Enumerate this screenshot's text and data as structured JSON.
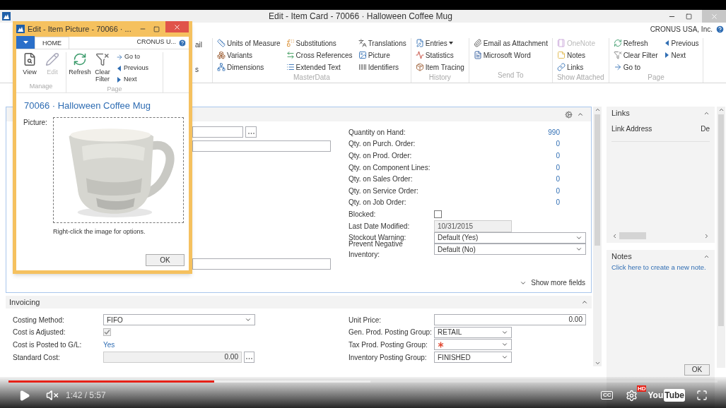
{
  "window": {
    "title": "Edit - Item Card - 70066 · Halloween Coffee Mug",
    "company": "CRONUS USA, Inc.",
    "ribbon": {
      "cut_items": [
        "ail",
        "s"
      ],
      "groups": [
        {
          "label": "MasterData",
          "columns": [
            [
              {
                "label": "Units of Measure",
                "disabled": false,
                "dropdown": false
              },
              {
                "label": "Variants",
                "disabled": false,
                "dropdown": false
              },
              {
                "label": "Dimensions",
                "disabled": false,
                "dropdown": false
              }
            ],
            [
              {
                "label": "Substitutions",
                "disabled": false,
                "dropdown": false
              },
              {
                "label": "Cross References",
                "disabled": false,
                "dropdown": false
              },
              {
                "label": "Extended Text",
                "disabled": false,
                "dropdown": false
              }
            ],
            [
              {
                "label": "Translations",
                "disabled": false,
                "dropdown": false
              },
              {
                "label": "Picture",
                "disabled": false,
                "dropdown": false
              },
              {
                "label": "Identifiers",
                "disabled": false,
                "dropdown": false
              }
            ]
          ]
        },
        {
          "label": "History",
          "columns": [
            [
              {
                "label": "Entries",
                "disabled": false,
                "dropdown": true
              },
              {
                "label": "Statistics",
                "disabled": false,
                "dropdown": false
              },
              {
                "label": "Item Tracing",
                "disabled": false,
                "dropdown": false
              }
            ]
          ]
        },
        {
          "label": "Send To",
          "columns": [
            [
              {
                "label": "Email as Attachment",
                "disabled": false,
                "dropdown": false
              },
              {
                "label": "Microsoft Word",
                "disabled": false,
                "dropdown": false
              }
            ]
          ]
        },
        {
          "label": "Show Attached",
          "columns": [
            [
              {
                "label": "OneNote",
                "disabled": true,
                "dropdown": false
              },
              {
                "label": "Notes",
                "disabled": false,
                "dropdown": false
              },
              {
                "label": "Links",
                "disabled": false,
                "dropdown": false
              }
            ]
          ]
        },
        {
          "label": "Page",
          "columns": [
            [
              {
                "label": "Refresh",
                "disabled": false,
                "dropdown": false
              },
              {
                "label": "Clear Filter",
                "disabled": false,
                "dropdown": false
              },
              {
                "label": "Go to",
                "disabled": false,
                "dropdown": false
              }
            ],
            [
              {
                "label": "Previous",
                "disabled": false,
                "dropdown": false
              },
              {
                "label": "Next",
                "disabled": false,
                "dropdown": false
              }
            ]
          ]
        }
      ]
    },
    "general": {
      "fields": [
        {
          "label": "Quantity on Hand:",
          "kind": "number",
          "value": "990"
        },
        {
          "label": "Qty. on Purch. Order:",
          "kind": "number",
          "value": "0"
        },
        {
          "label": "Qty. on Prod. Order:",
          "kind": "number",
          "value": "0"
        },
        {
          "label": "Qty. on Component Lines:",
          "kind": "number",
          "value": "0"
        },
        {
          "label": "Qty. on Sales Order:",
          "kind": "number",
          "value": "0"
        },
        {
          "label": "Qty. on Service Order:",
          "kind": "number",
          "value": "0"
        },
        {
          "label": "Qty. on Job Order:",
          "kind": "number",
          "value": "0"
        },
        {
          "label": "Blocked:",
          "kind": "checkbox",
          "checked": false
        },
        {
          "label": "Last Date Modified:",
          "kind": "readonly",
          "value": "10/31/2015"
        },
        {
          "label": "Stockout Warning:",
          "kind": "select",
          "value": "Default (Yes)"
        },
        {
          "label": "Prevent Negative Inventory:",
          "kind": "select",
          "value": "Default (No)"
        }
      ],
      "show_more": "Show more fields"
    },
    "invoicing": {
      "title": "Invoicing",
      "left": [
        {
          "label": "Costing Method:",
          "kind": "select",
          "value": "FIFO"
        },
        {
          "label": "Cost is Adjusted:",
          "kind": "checkbox",
          "checked": true
        },
        {
          "label": "Cost is Posted to G/L:",
          "kind": "link",
          "value": "Yes"
        },
        {
          "label": "Standard Cost:",
          "kind": "lookup",
          "value": "0.00"
        }
      ],
      "right": [
        {
          "label": "Unit Price:",
          "kind": "number",
          "value": "0.00"
        },
        {
          "label": "Gen. Prod. Posting Group:",
          "kind": "select",
          "value": "RETAIL"
        },
        {
          "label": "Tax Prod. Posting Group:",
          "kind": "required"
        },
        {
          "label": "Inventory Posting Group:",
          "kind": "select",
          "value": "FINISHED"
        }
      ]
    },
    "links": {
      "title": "Links",
      "columns": [
        "Link Address",
        "De"
      ]
    },
    "notes": {
      "title": "Notes",
      "link": "Click here to create a new note."
    },
    "ok_button": "OK"
  },
  "picture_dialog": {
    "title": "Edit - Item Picture - 70066 · ...",
    "tab": {
      "label": "HOME",
      "selected": true
    },
    "company": "CRONUS U...",
    "groups": [
      {
        "label": "Manage",
        "large": [
          {
            "label": "View",
            "disabled": false
          },
          {
            "label": "Edit",
            "disabled": true
          }
        ]
      },
      {
        "label": "Page",
        "large": [
          {
            "label": "Refresh",
            "disabled": false
          },
          {
            "label": "Clear Filter",
            "disabled": false
          }
        ],
        "small": [
          "Go to",
          "Previous",
          "Next"
        ]
      }
    ],
    "heading": "70066 · Halloween Coffee Mug",
    "picture_label": "Picture:",
    "hint": "Right-click the image for options.",
    "ok": "OK"
  },
  "video": {
    "progress": {
      "level": 0.29
    },
    "buffer": {
      "level": 0.51
    },
    "time": "1:42 / 5:57",
    "captions": "CC",
    "quality": "HD",
    "logo": [
      "You",
      "Tube"
    ]
  }
}
